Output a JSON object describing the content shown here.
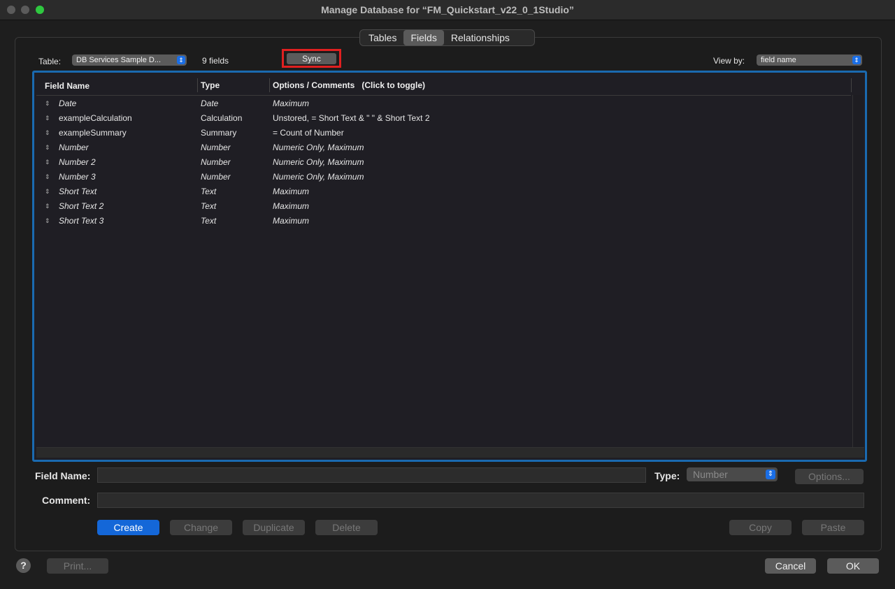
{
  "window": {
    "title": "Manage Database for “FM_Quickstart_v22_0_1Studio”"
  },
  "tabs": [
    {
      "label": "Tables"
    },
    {
      "label": "Fields",
      "active": true
    },
    {
      "label": "Relationships"
    }
  ],
  "toolbar": {
    "table_label": "Table:",
    "table_value": "DB Services Sample D...",
    "field_count": "9 fields",
    "sync_label": "Sync",
    "view_by_label": "View by:",
    "view_by_value": "field name"
  },
  "list": {
    "columns": [
      "Field Name",
      "Type",
      "Options / Comments   (Click to toggle)"
    ],
    "rows": [
      {
        "name": "Date",
        "type": "Date",
        "options": "Maximum",
        "italic": true
      },
      {
        "name": "exampleCalculation",
        "type": "Calculation",
        "options": "Unstored, = Short Text & \" \" & Short Text 2",
        "italic": false
      },
      {
        "name": "exampleSummary",
        "type": "Summary",
        "options": "= Count of Number",
        "italic": false
      },
      {
        "name": "Number",
        "type": "Number",
        "options": "Numeric Only, Maximum",
        "italic": true
      },
      {
        "name": "Number 2",
        "type": "Number",
        "options": "Numeric Only, Maximum",
        "italic": true
      },
      {
        "name": "Number 3",
        "type": "Number",
        "options": "Numeric Only, Maximum",
        "italic": true
      },
      {
        "name": "Short Text",
        "type": "Text",
        "options": "Maximum",
        "italic": true
      },
      {
        "name": "Short Text 2",
        "type": "Text",
        "options": "Maximum",
        "italic": true
      },
      {
        "name": "Short Text 3",
        "type": "Text",
        "options": "Maximum",
        "italic": true
      }
    ]
  },
  "form": {
    "field_name_label": "Field Name:",
    "field_name_value": "",
    "type_label": "Type:",
    "type_value": "Number",
    "options_label": "Options...",
    "comment_label": "Comment:",
    "comment_value": ""
  },
  "buttons": {
    "create": "Create",
    "change": "Change",
    "duplicate": "Duplicate",
    "delete": "Delete",
    "copy": "Copy",
    "paste": "Paste",
    "help": "?",
    "print": "Print...",
    "cancel": "Cancel",
    "ok": "OK"
  },
  "colors": {
    "accent": "#1467d8",
    "highlight": "#e02020",
    "selection_border": "#1a6ab0"
  }
}
